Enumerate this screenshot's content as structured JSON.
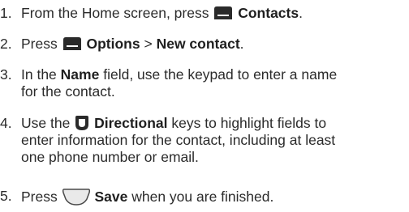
{
  "steps": [
    {
      "num": "1.",
      "pre": "From the Home screen, press",
      "bold": "Contacts",
      "post": "."
    },
    {
      "num": "2.",
      "pre": "Press",
      "bold1": "Options",
      "sep": ">",
      "bold2": "New contact",
      "post": "."
    },
    {
      "num": "3.",
      "pre": "In the",
      "bold": "Name",
      "post_line1": "field, use the keypad to enter a name",
      "line2": "for the contact."
    },
    {
      "num": "4.",
      "pre": "Use the",
      "bold": "Directional",
      "post_line1": "keys to highlight fields to",
      "line2": "enter information for the contact, including at least",
      "line3": "one phone number or email."
    },
    {
      "num": "5.",
      "pre": "Press",
      "bold": "Save",
      "post": "when you are finished."
    }
  ],
  "icons": {
    "left_softkey": "left-softkey-icon",
    "directional": "directional-key-icon",
    "center_softkey": "center-softkey-icon"
  },
  "colors": {
    "text": "#2b2b2b",
    "icon_dark": "#2a2a2a",
    "icon_light_fill": "#e9e9e9",
    "icon_light_stroke": "#4a4a4a"
  }
}
